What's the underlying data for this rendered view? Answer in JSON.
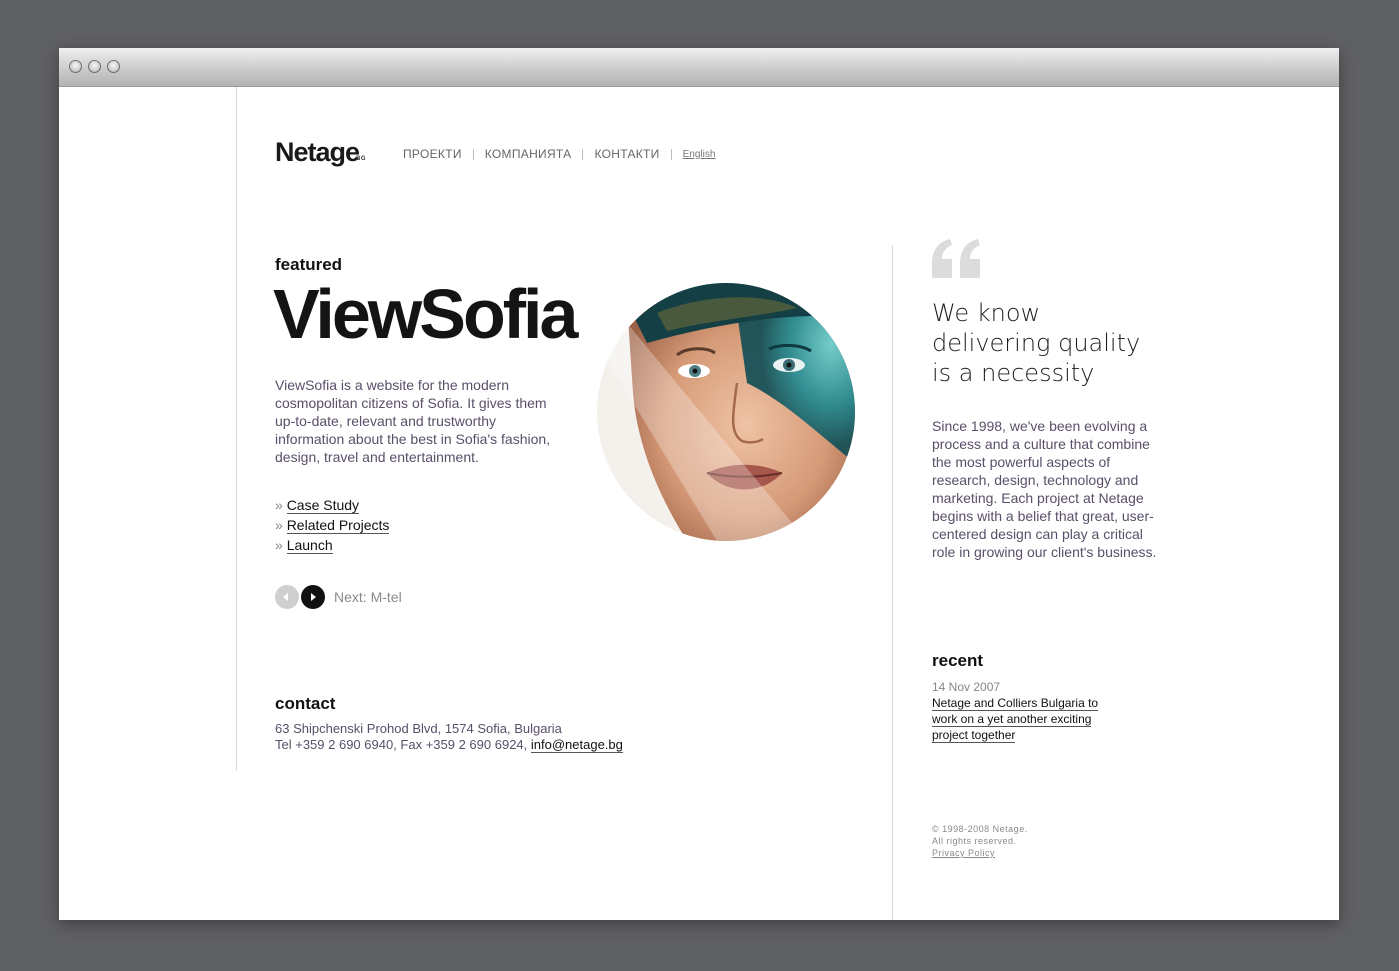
{
  "logo": {
    "name": "Netage",
    "suffix": "BG"
  },
  "nav": {
    "items": [
      "ПРОЕКТИ",
      "КОМПАНИЯТА",
      "КОНТАКТИ"
    ],
    "language": "English"
  },
  "featured": {
    "kicker": "featured",
    "title": "ViewSofia",
    "description": "ViewSofia is a website for the modern cosmopolitan citizens of Sofia. It gives them up-to-date, relevant and trustworthy information about the best in Sofia's fashion, design, travel and entertainment.",
    "links": [
      "Case Study",
      "Related Projects",
      "Launch"
    ],
    "link_bullet": "»",
    "next_label": "Next: M-tel"
  },
  "contact": {
    "heading": "contact",
    "address": "63 Shipchenski Prohod Blvd, 1574 Sofia, Bulgaria",
    "phones": "Tel +359 2 690 6940, Fax +359 2 690 6924, ",
    "email": "info@netage.bg"
  },
  "sidebar": {
    "tagline": [
      "We know",
      "delivering quality",
      "is a necessity"
    ],
    "about": "Since 1998, we've been evolving a process and a culture that combine the most powerful aspects of research, design, technology and marketing. Each project at Netage begins with a belief that great, user-centered design can play a critical role in growing our client's business.",
    "recent": {
      "heading": "recent",
      "date": "14 Nov 2007",
      "headline": "Netage and Colliers Bulgaria to work on a yet another exciting project together"
    },
    "footer": {
      "copyright": "© 1998-2008 Netage.",
      "rights": "All rights reserved.",
      "privacy": "Privacy Policy"
    }
  },
  "colors": {
    "page_bg": "#5f6063",
    "body_text": "#5a4f68",
    "heading": "#141414",
    "quote_mark": "#dcdcdc",
    "accent_teal": "#1f8a92"
  }
}
